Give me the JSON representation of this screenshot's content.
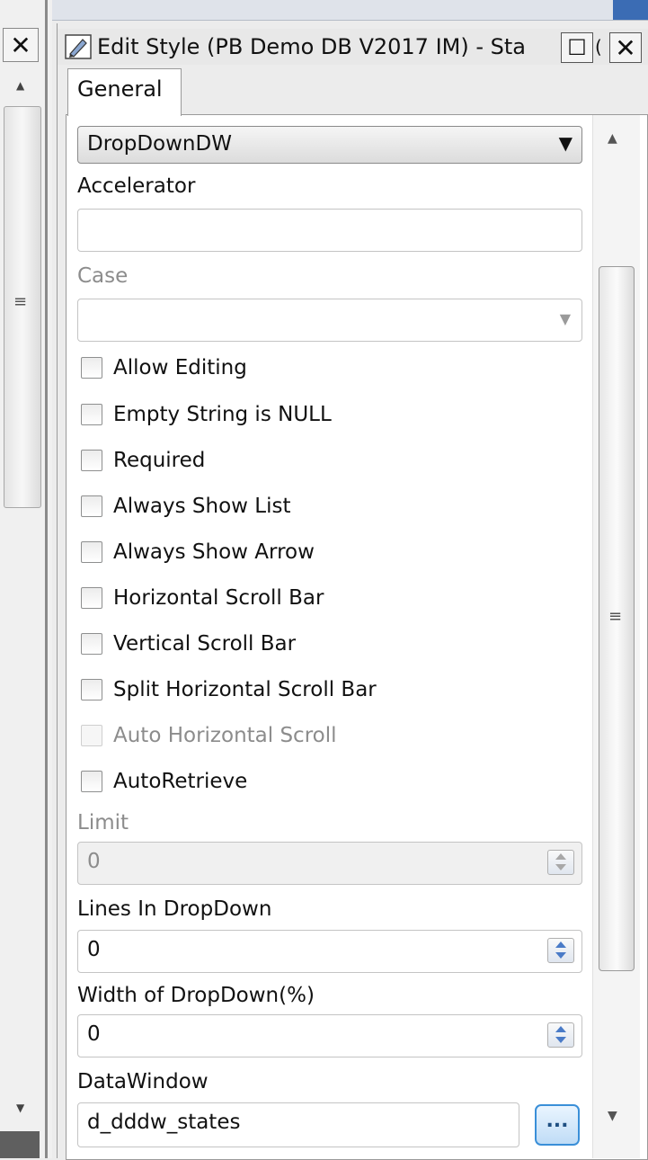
{
  "window": {
    "title": "Edit Style (PB Demo DB V2017 IM) - Sta",
    "title_overflow": "(",
    "close_glyph": "✕",
    "maximize_glyph": "☐",
    "left_close_glyph": "✕"
  },
  "tabs": {
    "general": "General"
  },
  "style_type": {
    "value": "DropDownDW"
  },
  "fields": {
    "accelerator": {
      "label": "Accelerator",
      "value": ""
    },
    "case": {
      "label": "Case",
      "value": ""
    }
  },
  "checkboxes": [
    {
      "label": "Allow Editing",
      "checked": false,
      "enabled": true
    },
    {
      "label": "Empty String is NULL",
      "checked": false,
      "enabled": true
    },
    {
      "label": "Required",
      "checked": false,
      "enabled": true
    },
    {
      "label": "Always Show List",
      "checked": false,
      "enabled": true
    },
    {
      "label": "Always Show Arrow",
      "checked": false,
      "enabled": true
    },
    {
      "label": "Horizontal Scroll Bar",
      "checked": false,
      "enabled": true
    },
    {
      "label": "Vertical Scroll Bar",
      "checked": false,
      "enabled": true
    },
    {
      "label": "Split Horizontal Scroll Bar",
      "checked": false,
      "enabled": true
    },
    {
      "label": "Auto Horizontal Scroll",
      "checked": false,
      "enabled": false
    },
    {
      "label": "AutoRetrieve",
      "checked": false,
      "enabled": true
    }
  ],
  "limit": {
    "label": "Limit",
    "value": "0"
  },
  "lines_in_dropdown": {
    "label": "Lines In DropDown",
    "value": "0"
  },
  "width_of_dropdown": {
    "label": "Width of DropDown(%)",
    "value": "0"
  },
  "datawindow": {
    "label": "DataWindow",
    "value": "d_dddw_states",
    "browse_label": "..."
  },
  "icons": {
    "app": "edit-style-icon",
    "dropdown": "dropdown-arrow-icon",
    "spin": "spinner-icon",
    "scroll_up": "scroll-up-arrow-icon",
    "scroll_down": "scroll-down-arrow-icon",
    "grip": "scroll-grip-icon"
  }
}
